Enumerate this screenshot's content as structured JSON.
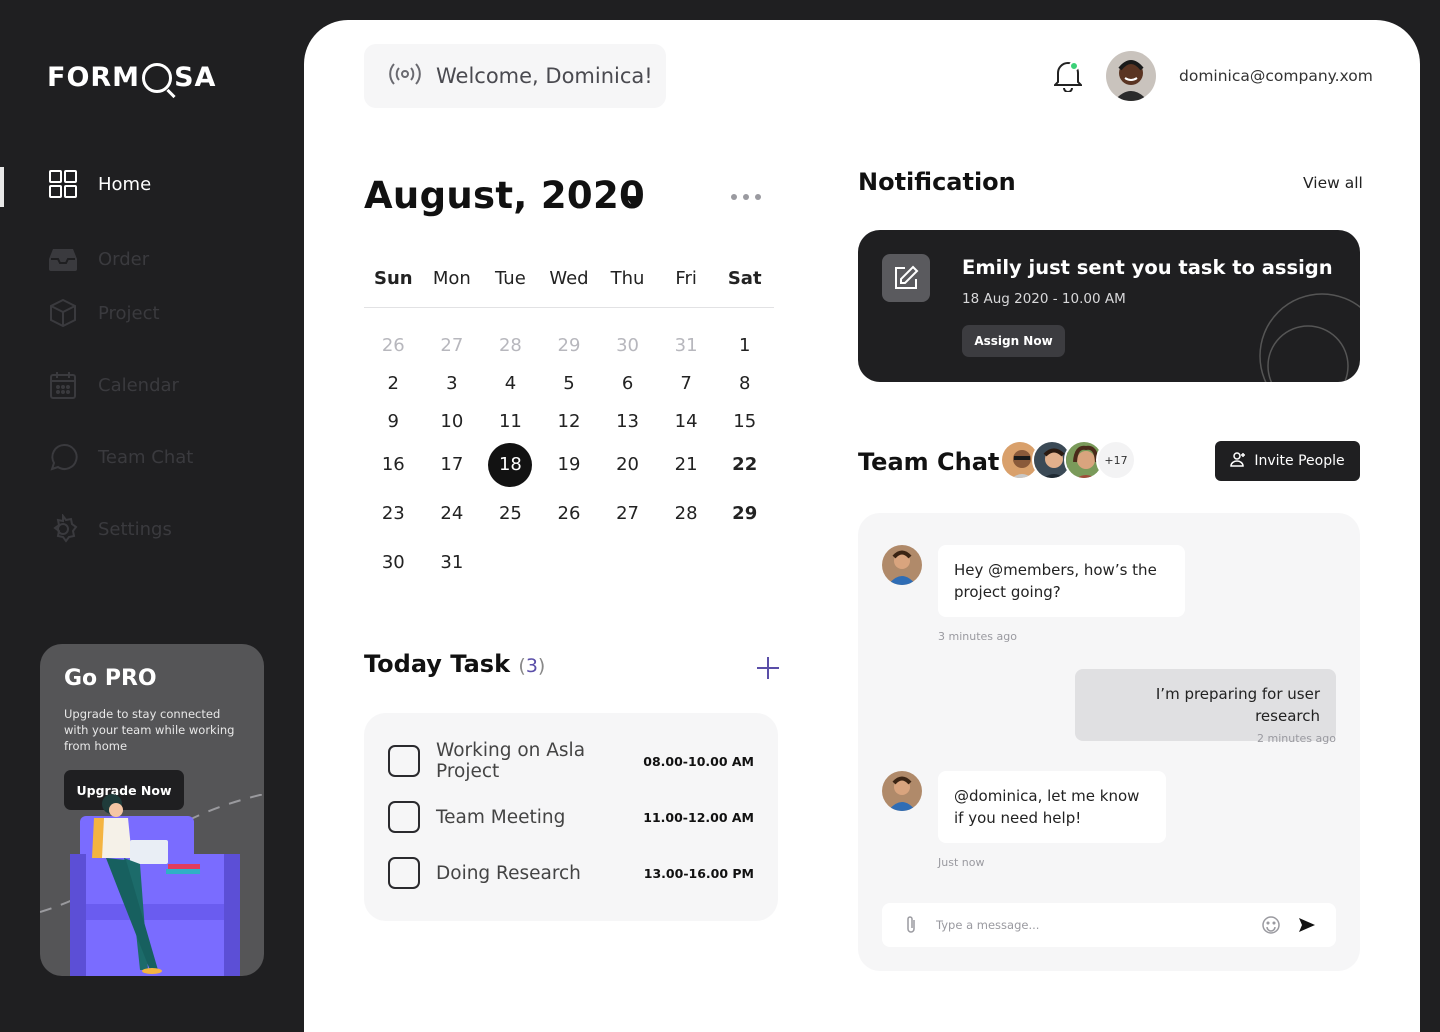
{
  "brand": {
    "logo_left": "FORM",
    "logo_right": "SA"
  },
  "sidebar": {
    "items": [
      {
        "label": "Home",
        "icon": "grid-icon",
        "active": true
      },
      {
        "label": "Order",
        "icon": "inbox-icon",
        "active": false
      },
      {
        "label": "Project",
        "icon": "cube-icon",
        "active": false
      },
      {
        "label": "Calendar",
        "icon": "calendar-icon",
        "active": false
      },
      {
        "label": "Team Chat",
        "icon": "chat-icon",
        "active": false
      },
      {
        "label": "Settings",
        "icon": "gear-icon",
        "active": false
      }
    ]
  },
  "promo": {
    "title": "Go PRO",
    "text": "Upgrade to stay connected with your team while working from home",
    "button": "Upgrade Now"
  },
  "header": {
    "welcome": "Welcome, Dominica!",
    "email": "dominica@company.xom"
  },
  "calendar": {
    "title": "August, 2020",
    "weekdays": [
      "Sun",
      "Mon",
      "Tue",
      "Wed",
      "Thu",
      "Fri",
      "Sat"
    ],
    "weeks": [
      [
        "26",
        "27",
        "28",
        "29",
        "30",
        "31",
        "1"
      ],
      [
        "2",
        "3",
        "4",
        "5",
        "6",
        "7",
        "8"
      ],
      [
        "9",
        "10",
        "11",
        "12",
        "13",
        "14",
        "15"
      ],
      [
        "16",
        "17",
        "18",
        "19",
        "20",
        "21",
        "22"
      ],
      [
        "23",
        "24",
        "25",
        "26",
        "27",
        "28",
        "29"
      ],
      [
        "30",
        "31",
        "",
        "",
        "",
        "",
        ""
      ]
    ],
    "selected_day": "18"
  },
  "tasks": {
    "title": "Today Task",
    "count": "3",
    "items": [
      {
        "name": "Working on Asla Project",
        "time": "08.00-10.00 AM"
      },
      {
        "name": "Team Meeting",
        "time": "11.00-12.00 AM"
      },
      {
        "name": "Doing Research",
        "time": "13.00-16.00 PM"
      }
    ]
  },
  "notification": {
    "title": "Notification",
    "view_all": "View all",
    "message": "Emily just sent you task to assign",
    "date": "18 Aug 2020 - 10.00 AM",
    "button": "Assign Now"
  },
  "team_chat": {
    "title": "Team Chat",
    "more_members": "+17",
    "invite_button": "Invite People",
    "messages": [
      {
        "text": "Hey @members, how’s the project going?",
        "time": "3 minutes ago",
        "mine": false
      },
      {
        "text": "I’m preparing for user research",
        "time": "2 minutes ago",
        "mine": true
      },
      {
        "text": "@dominica, let me know if you need help!",
        "time": "Just now",
        "mine": false
      }
    ],
    "input_placeholder": "Type a message..."
  },
  "colors": {
    "sidebar_bg": "#1f1f21",
    "main_bg": "#ffffff",
    "panel_bg": "#f6f6f7",
    "accent_purple": "#5a4ea8",
    "promo_bg": "#555557"
  }
}
